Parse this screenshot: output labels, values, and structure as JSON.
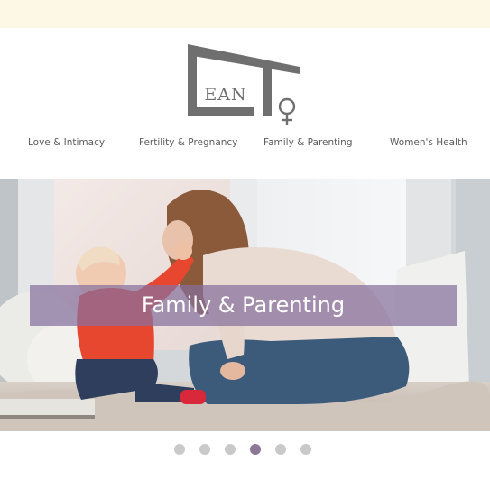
{
  "brand": {
    "logo_letters": "EAN"
  },
  "nav": {
    "items": [
      {
        "label": "Love & Intimacy"
      },
      {
        "label": "Fertility & Pregnancy"
      },
      {
        "label": "Family & Parenting"
      },
      {
        "label": "Women's Health"
      }
    ]
  },
  "hero": {
    "caption": "Family & Parenting",
    "slides_total": 6,
    "active_slide": 4
  },
  "teaser": {
    "text": ""
  },
  "colors": {
    "top_strip": "#fdf8e6",
    "caption_band": "#86709c",
    "dot_active": "#8a7896",
    "dot_inactive": "#c9c9c9",
    "logo_gray": "#6f6f6f"
  }
}
